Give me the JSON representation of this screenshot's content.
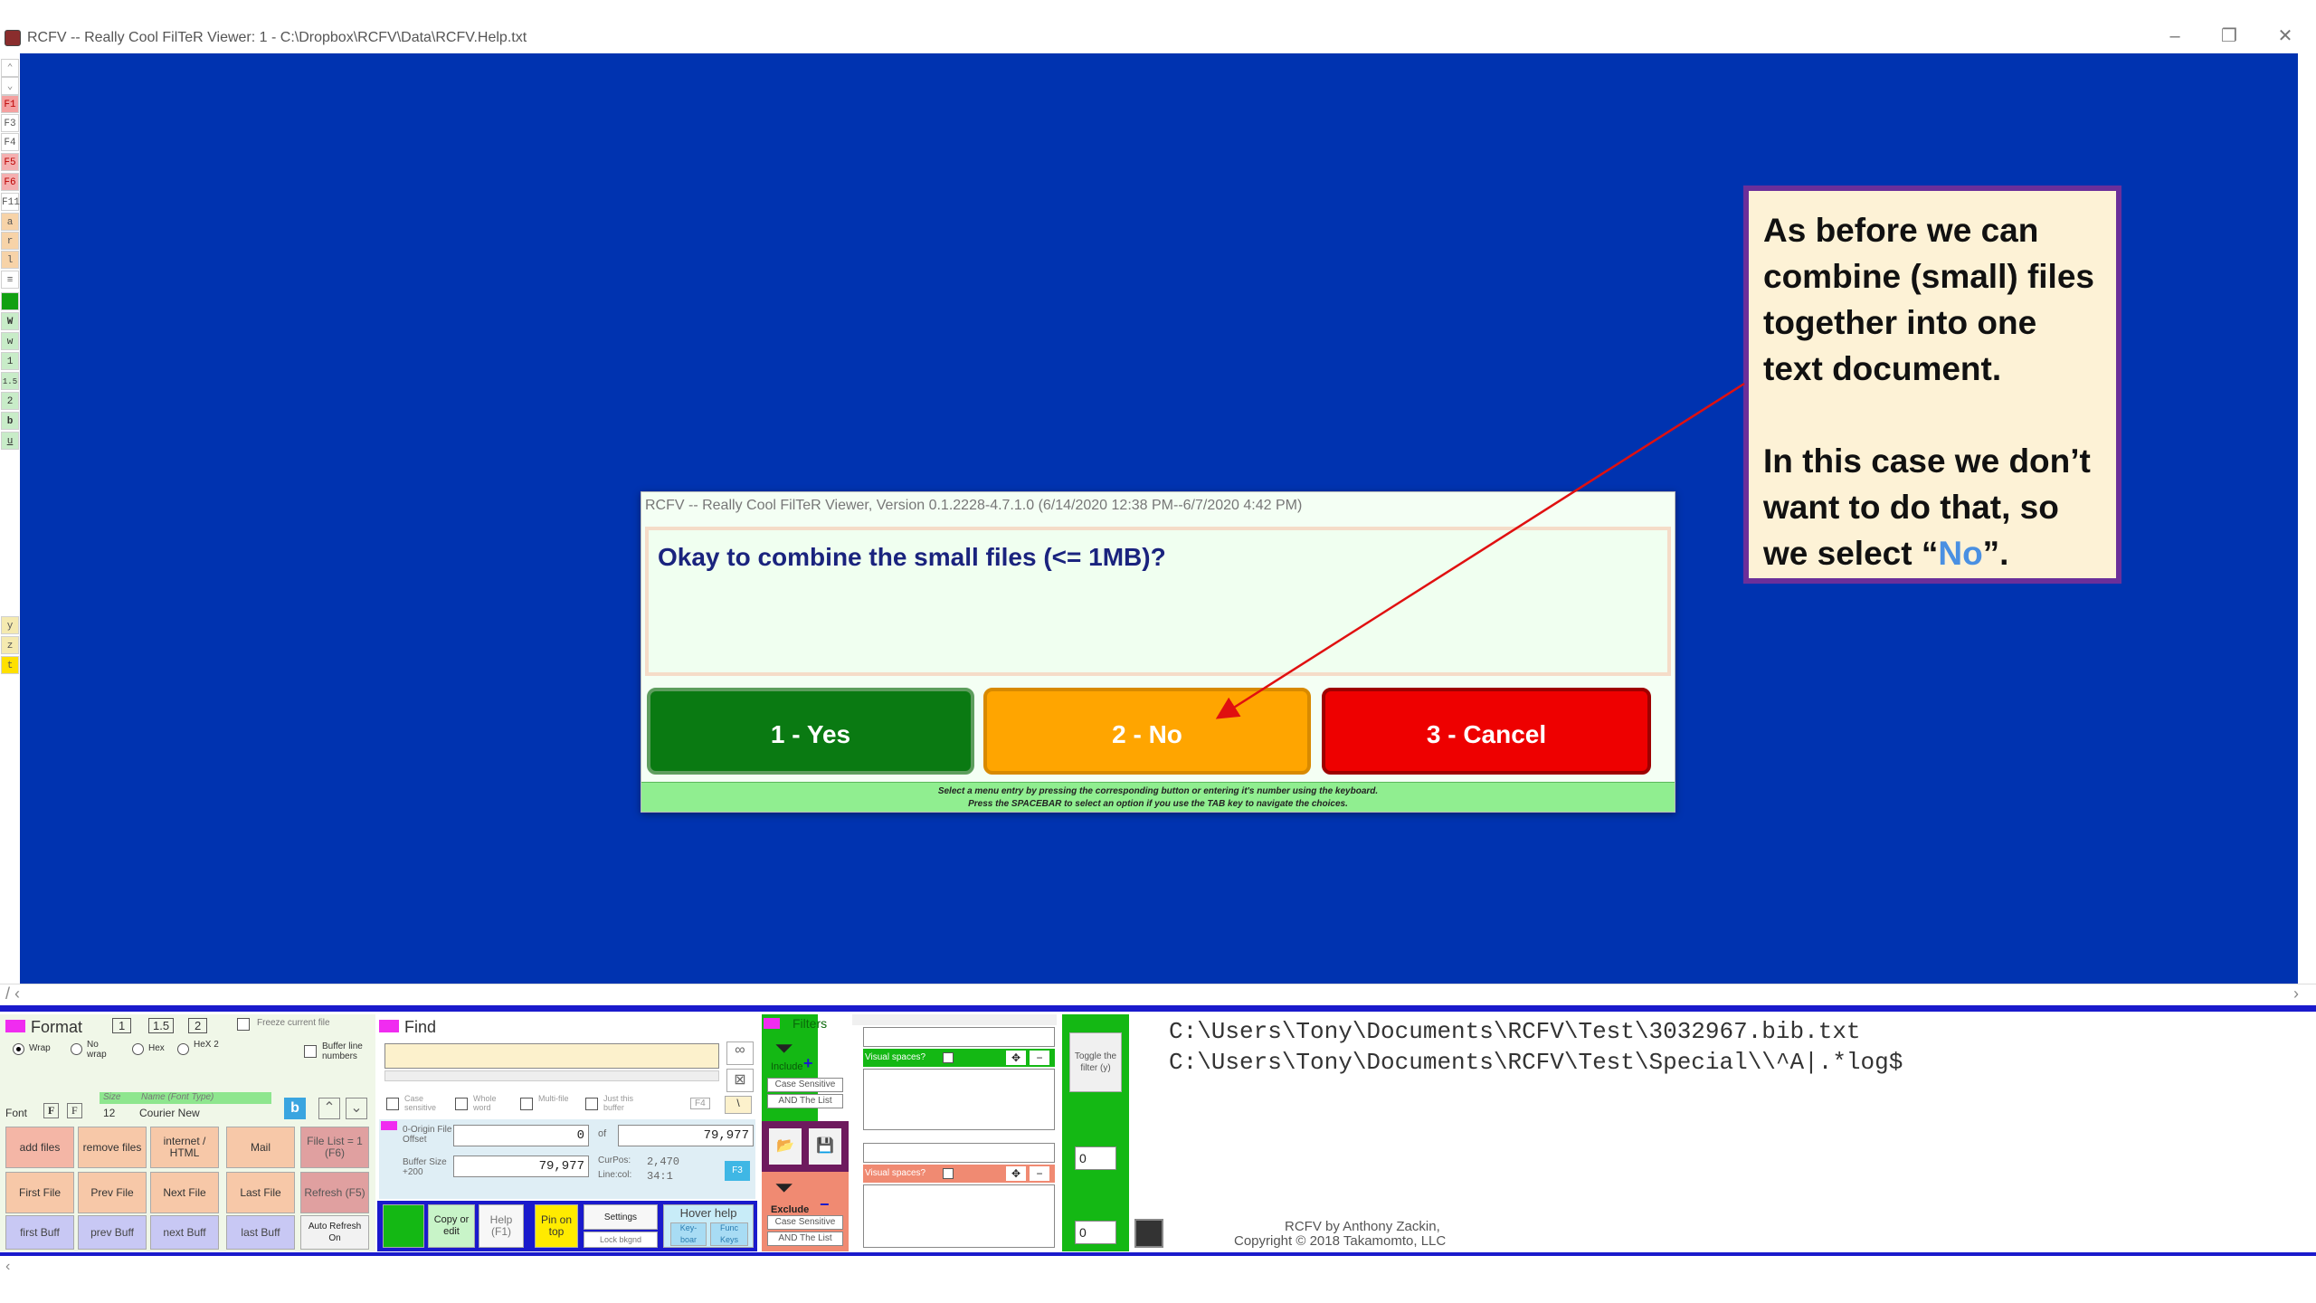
{
  "window": {
    "title": "RCFV -- Really Cool FilTeR Viewer: 1 - C:\\Dropbox\\RCFV\\Data\\RCFV.Help.txt",
    "minimize": "–",
    "restore": "❐",
    "close": "✕"
  },
  "left_strip": [
    "F1",
    "F3",
    "F4",
    "F5",
    "F6",
    "F11",
    "a",
    "r",
    "l",
    "≡",
    "W",
    "w",
    "1",
    "1.5",
    "2",
    "b",
    "u",
    "y",
    "z",
    "t"
  ],
  "annotation": {
    "para1": "As before we can combine (small) files together into one text document.",
    "para2_before": "In this case we don’t want to do that, so we select “",
    "para2_highlight": "No",
    "para2_after": "”."
  },
  "dialog": {
    "title": "RCFV -- Really Cool FilTeR Viewer, Version 0.1.2228-4.7.1.0 (6/14/2020 12:38 PM--6/7/2020 4:42 PM)",
    "message": "Okay to combine the small files (<= 1MB)?",
    "yes_label": "1 - Yes",
    "no_label": "2 - No",
    "cancel_label": "3 - Cancel",
    "hint_line1": "Select a menu entry by pressing the corresponding button or entering it's number using the keyboard.",
    "hint_line2": "Press the SPACEBAR to select an option if you use the TAB key to navigate the choices.",
    "colors": {
      "yes": "#0a7a12",
      "no": "#ffa500",
      "cancel": "#ee0000"
    }
  },
  "format_panel": {
    "title": "Format",
    "spacing": [
      "1",
      "1.5",
      "2"
    ],
    "freeze_label": "Freeze current file",
    "wrap_label": "Wrap",
    "nowrap_label": "No wrap",
    "hex_label": "Hex",
    "hex2_label": "HeX 2",
    "buffer_line_numbers": "Buffer line numbers",
    "font_label": "Font",
    "size_header": "Size",
    "name_header": "Name (Font Type)",
    "size_value": "12",
    "font_name": "Courier New",
    "add_files": "add files",
    "remove_files": "remove files",
    "internet_html": "internet / HTML",
    "mail": "Mail",
    "file_list": "File List = 1 (F6)",
    "first_file": "First File",
    "prev_file": "Prev File",
    "next_file": "Next File",
    "last_file": "Last File",
    "refresh": "Refresh (F5)",
    "first_buff": "first Buff",
    "prev_buff": "prev Buff",
    "next_buff": "next Buff",
    "last_buff": "last Buff",
    "auto_refresh": "Auto Refresh On"
  },
  "find_panel": {
    "title": "Find",
    "case_sensitive": "Case sensitive",
    "whole_word": "Whole word",
    "multi_file": "Multi-file",
    "just_buffer": "Just this buffer",
    "origin_label": "0-Origin File Offset",
    "origin_value": "0",
    "of_label": "of",
    "total_value": "79,977",
    "buffer_size_label": "Buffer Size +200",
    "buffer_size_value": "79,977",
    "curpos_label": "CurPos:",
    "curpos_value": "2,470",
    "linecol_label": "Line:col:",
    "linecol_value": "34:1",
    "f3": "F3",
    "f4": "F4",
    "copy_edit": "Copy or edit",
    "help": "Help (F1)",
    "pin_on_top": "Pin on top",
    "settings": "Settings",
    "lock_bkgnd": "Lock bkgnd",
    "hover_help": "Hover help",
    "keyboard": "Key-boar",
    "func_keys": "Func Keys"
  },
  "filter_panel": {
    "title": "Filters",
    "include": "Include",
    "exclude": "Exclude",
    "case_sensitive": "Case Sensitive",
    "and_the_list": "AND The List",
    "visual_spaces": "Visual spaces?",
    "toggle_filter": "Toggle the filter (y)",
    "counter1": "0",
    "counter2": "0"
  },
  "paths": [
    "C:\\Users\\Tony\\Documents\\RCFV\\Test\\3032967.bib.txt",
    "C:\\Users\\Tony\\Documents\\RCFV\\Test\\Special\\\\^A|.*log$"
  ],
  "credits": {
    "line1": "RCFV by Anthony Zackin,",
    "line2": "Copyright © 2018 Takamomto, LLC"
  }
}
